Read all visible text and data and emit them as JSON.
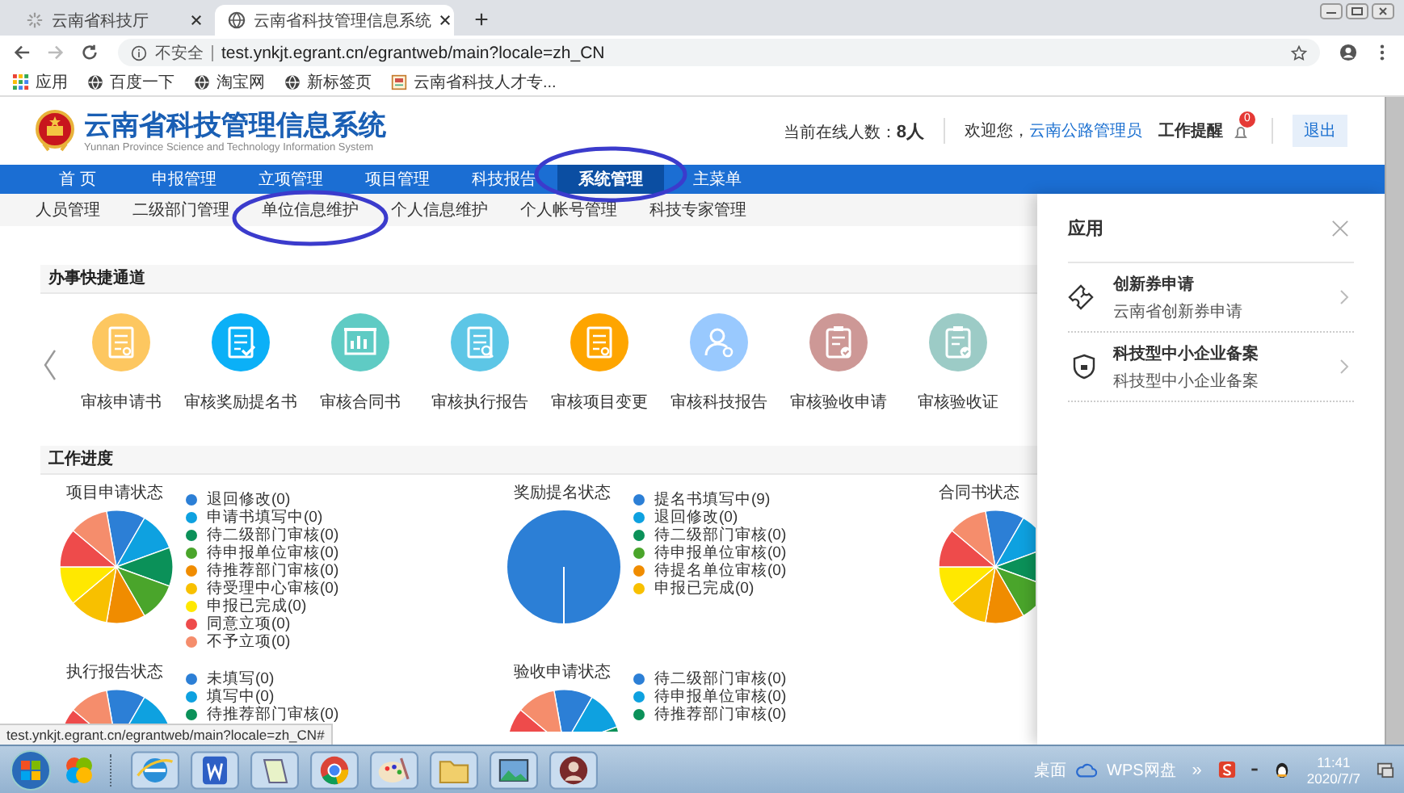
{
  "browser": {
    "tabs": [
      {
        "title": "云南省科技厅",
        "selected": false
      },
      {
        "title": "云南省科技管理信息系统",
        "selected": true
      }
    ],
    "new_tab": "+",
    "security": "不安全",
    "url": "test.ynkjt.egrant.cn/egrantweb/main?locale=zh_CN",
    "bookmarks": [
      {
        "label": "应用",
        "kind": "apps"
      },
      {
        "label": "百度一下",
        "kind": "globe"
      },
      {
        "label": "淘宝网",
        "kind": "globe"
      },
      {
        "label": "新标签页",
        "kind": "globe"
      },
      {
        "label": "云南省科技人才专...",
        "kind": "page"
      }
    ]
  },
  "header": {
    "title": "云南省科技管理信息系统",
    "subtitle": "Yunnan Province Science and Technology Information System",
    "online_label": "当前在线人数：",
    "online_count": "8人",
    "welcome": "欢迎您，",
    "user": "云南公路管理员",
    "reminder": "工作提醒",
    "reminder_badge": "0",
    "logout": "退出"
  },
  "nav": [
    {
      "label": "首 页",
      "selected": false
    },
    {
      "label": "申报管理",
      "selected": false
    },
    {
      "label": "立项管理",
      "selected": false
    },
    {
      "label": "项目管理",
      "selected": false
    },
    {
      "label": "科技报告",
      "selected": false
    },
    {
      "label": "系统管理",
      "selected": true
    },
    {
      "label": "主菜单",
      "selected": false
    }
  ],
  "subnav": [
    "人员管理",
    "二级部门管理",
    "单位信息维护",
    "个人信息维护",
    "个人帐号管理",
    "科技专家管理"
  ],
  "quick": {
    "title": "办事快捷通道",
    "items": [
      {
        "label": "审核申请书",
        "color": "#fdc760",
        "kind": "doc"
      },
      {
        "label": "审核奖励提名书",
        "color": "#0bb0f7",
        "kind": "doc-check"
      },
      {
        "label": "审核合同书",
        "color": "#5fcbc4",
        "kind": "chart"
      },
      {
        "label": "审核执行报告",
        "color": "#5dc6e6",
        "kind": "doc-search"
      },
      {
        "label": "审核项目变更",
        "color": "#fea500",
        "kind": "receipt"
      },
      {
        "label": "审核科技报告",
        "color": "#99c9fe",
        "kind": "person"
      },
      {
        "label": "审核验收申请",
        "color": "#cd9896",
        "kind": "clipboard"
      },
      {
        "label": "审核验收证",
        "color": "#9ccbc6",
        "kind": "clipboard"
      }
    ]
  },
  "progress": {
    "title": "工作进度",
    "charts": [
      {
        "title": "项目申请状态",
        "kind": "equal",
        "legend": [
          {
            "label": "退回修改(0)",
            "color": "#2c7fd6"
          },
          {
            "label": "申请书填写中(0)",
            "color": "#0ea1e0"
          },
          {
            "label": "待二级部门审核(0)",
            "color": "#0b9159"
          },
          {
            "label": "待申报单位审核(0)",
            "color": "#4aa52b"
          },
          {
            "label": "待推荐部门审核(0)",
            "color": "#f08c00"
          },
          {
            "label": "待受理中心审核(0)",
            "color": "#f8c000"
          },
          {
            "label": "申报已完成(0)",
            "color": "#ffe800"
          },
          {
            "label": "同意立项(0)",
            "color": "#ee4b4b"
          },
          {
            "label": "不予立项(0)",
            "color": "#f58d6c"
          }
        ]
      },
      {
        "title": "奖励提名状态",
        "kind": "full",
        "legend": [
          {
            "label": "提名书填写中(9)",
            "color": "#2c7fd6"
          },
          {
            "label": "退回修改(0)",
            "color": "#0ea1e0"
          },
          {
            "label": "待二级部门审核(0)",
            "color": "#0b9159"
          },
          {
            "label": "待申报单位审核(0)",
            "color": "#4aa52b"
          },
          {
            "label": "待提名单位审核(0)",
            "color": "#f08c00"
          },
          {
            "label": "申报已完成(0)",
            "color": "#f8c000"
          }
        ]
      },
      {
        "title": "合同书状态",
        "kind": "equal"
      },
      {
        "title": "执行报告状态",
        "kind": "equal",
        "legend": [
          {
            "label": "未填写(0)",
            "color": "#2c7fd6"
          },
          {
            "label": "填写中(0)",
            "color": "#0ea1e0"
          },
          {
            "label": "待推荐部门审核(0)",
            "color": "#0b9159"
          }
        ]
      },
      {
        "title": "验收申请状态",
        "kind": "equal",
        "legend": [
          {
            "label": "待二级部门审核(0)",
            "color": "#2c7fd6"
          },
          {
            "label": "待申报单位审核(0)",
            "color": "#0ea1e0"
          },
          {
            "label": "待推荐部门审核(0)",
            "color": "#0b9159"
          }
        ]
      }
    ]
  },
  "panel": {
    "title": "应用",
    "items": [
      {
        "title": "创新券申请",
        "subtitle": "云南省创新券申请",
        "kind": "ticket"
      },
      {
        "title": "科技型中小企业备案",
        "subtitle": "科技型中小企业备案",
        "kind": "shield"
      }
    ]
  },
  "status_url": "test.ynkjt.egrant.cn/egrantweb/main?locale=zh_CN#",
  "taskbar": {
    "desktop": "桌面",
    "cloud": "WPS网盘",
    "more": "»",
    "time": "11:41",
    "date": "2020/7/7"
  }
}
